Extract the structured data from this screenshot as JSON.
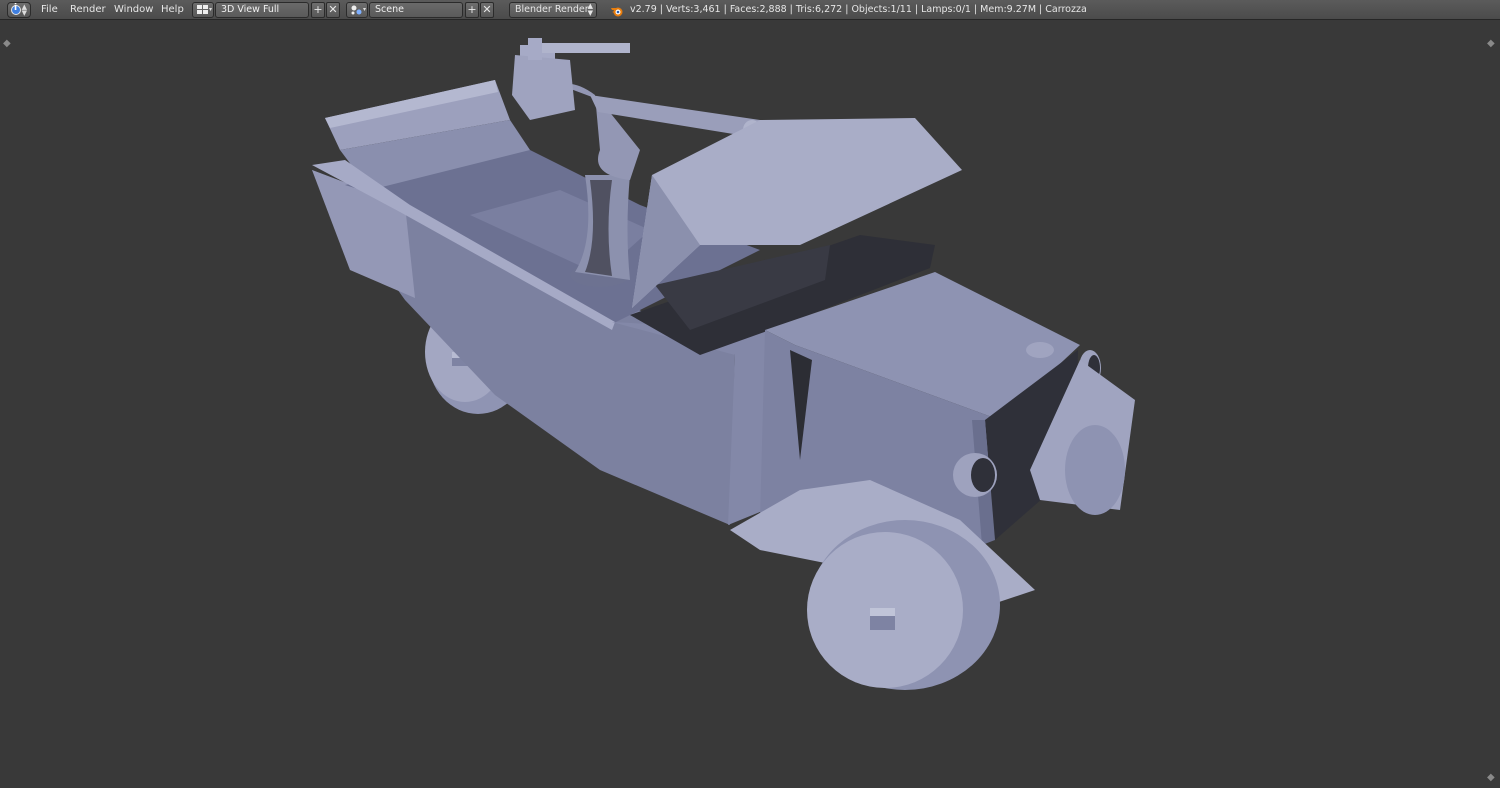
{
  "header": {
    "menus": [
      "File",
      "Render",
      "Window",
      "Help"
    ],
    "screen_layout": "3D View Full",
    "scene": "Scene",
    "render_engine": "Blender Render",
    "stats": "v2.79 | Verts:3,461 | Faces:2,888 | Tris:6,272 | Objects:1/11 | Lamps:0/1 | Mem:9.27M | Carrozza",
    "add_symbol": "+",
    "remove_symbol": "✕"
  },
  "colors": {
    "viewport_bg": "#393939",
    "header_bg": "#4f4f4f",
    "model_face": "#8a8fae",
    "model_dark": "#2b2c33",
    "accent_blue": "#3f7fe0"
  },
  "icons": [
    "info-icon",
    "screen-layout-icon",
    "scene-icon",
    "blender-logo-icon"
  ]
}
